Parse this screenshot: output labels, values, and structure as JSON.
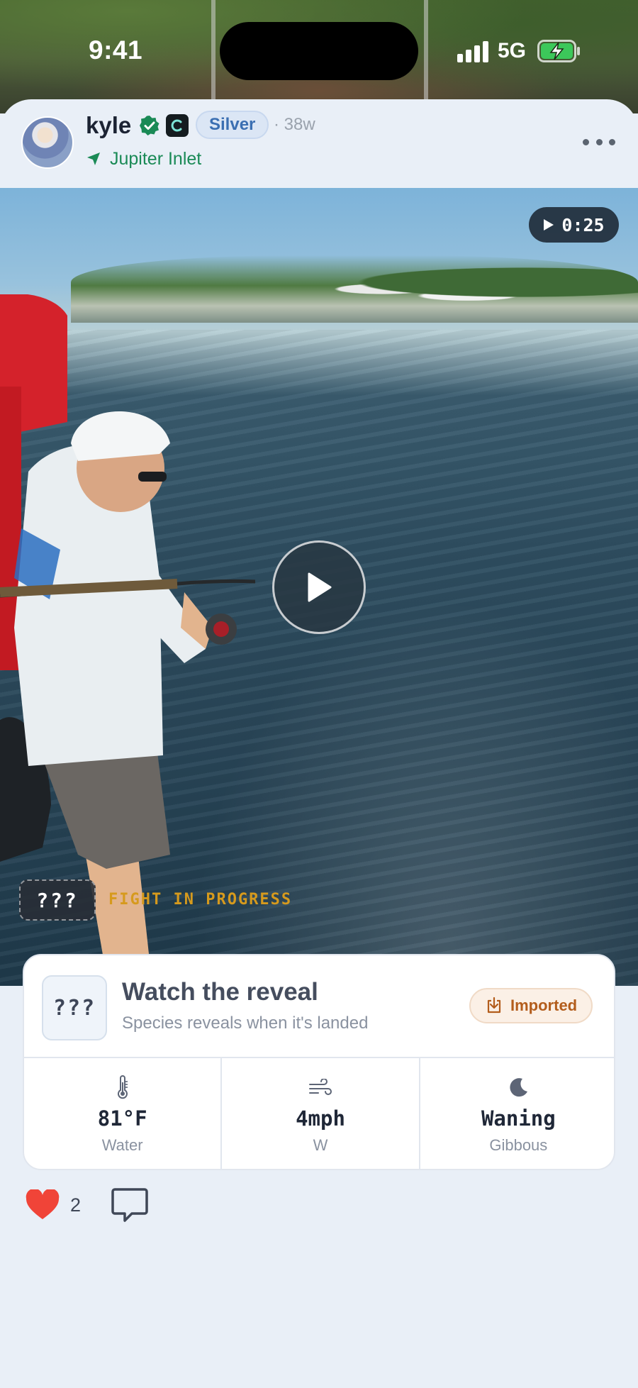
{
  "status_bar": {
    "time": "9:41",
    "network": "5G"
  },
  "post": {
    "username": "kyle",
    "tier": "Silver",
    "age": "· 38w",
    "location": "Jupiter Inlet",
    "video": {
      "duration": "0:25",
      "mystery_label": "???",
      "status_label": "FIGHT IN PROGRESS"
    },
    "reveal": {
      "species_placeholder": "???",
      "title": "Watch the reveal",
      "subtitle": "Species reveals when it's landed",
      "source_badge": "Imported"
    },
    "conditions": [
      {
        "icon": "thermometer-icon",
        "value": "81°F",
        "label": "Water"
      },
      {
        "icon": "wind-icon",
        "value": "4mph",
        "label": "W"
      },
      {
        "icon": "moon-icon",
        "value": "Waning",
        "label": "Gibbous"
      }
    ],
    "likes": "2"
  },
  "colors": {
    "accent_green": "#1a8a56",
    "tier_blue": "#3b6fb2",
    "fight_gold": "#d69a1d",
    "imported_orange": "#b35d1c",
    "like_red": "#f04438"
  }
}
